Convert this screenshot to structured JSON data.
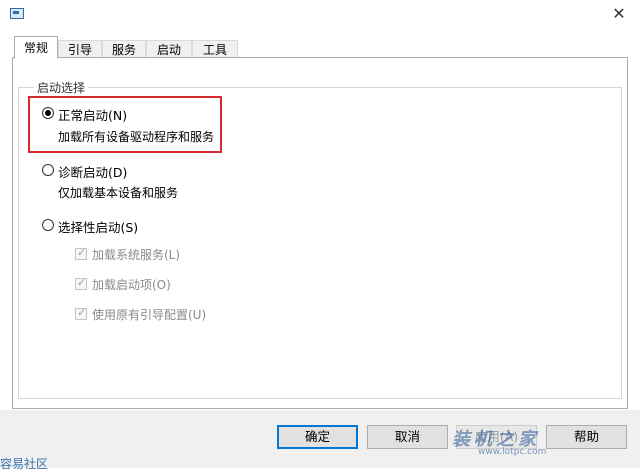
{
  "window": {
    "close_glyph": "✕"
  },
  "tabs": [
    {
      "label": "常规",
      "active": true
    },
    {
      "label": "引导",
      "active": false
    },
    {
      "label": "服务",
      "active": false
    },
    {
      "label": "启动",
      "active": false
    },
    {
      "label": "工具",
      "active": false
    }
  ],
  "startup_group": {
    "title": "启动选择",
    "options": [
      {
        "label": "正常启动(N)",
        "description": "加载所有设备驱动程序和服务",
        "selected": true
      },
      {
        "label": "诊断启动(D)",
        "description": "仅加载基本设备和服务",
        "selected": false
      },
      {
        "label": "选择性启动(S)",
        "selected": false
      }
    ],
    "selective_items": [
      {
        "label": "加载系统服务(L)",
        "checked": true,
        "enabled": false
      },
      {
        "label": "加载启动项(O)",
        "checked": true,
        "enabled": false
      },
      {
        "label": "使用原有引导配置(U)",
        "checked": true,
        "enabled": false
      }
    ]
  },
  "buttons": {
    "ok": "确定",
    "cancel": "取消",
    "apply": "应用(A)",
    "help": "帮助"
  },
  "watermark": {
    "text": "装机之家",
    "url": "www.lotpc.com"
  },
  "bottom_left_text": "容易社区",
  "colors": {
    "highlight": "#d32b2b",
    "default_button_border": "#0078d7"
  }
}
